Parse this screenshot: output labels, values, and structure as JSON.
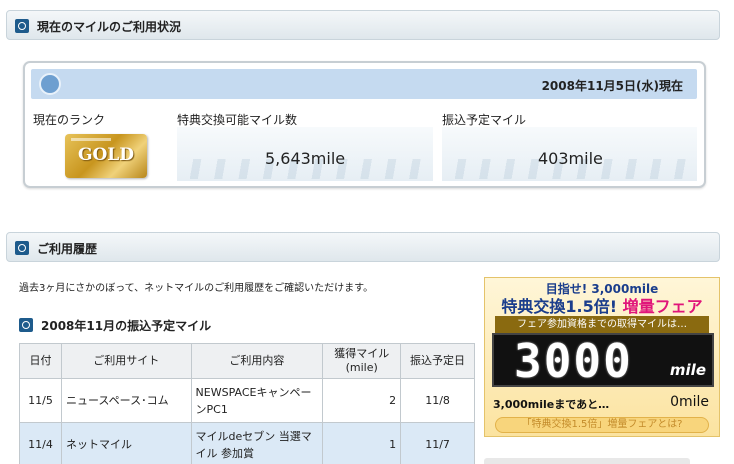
{
  "section_status": {
    "title": "現在のマイルのご利用状況"
  },
  "status": {
    "date": "2008年11月5日(水)現在",
    "rank_label": "現在のランク",
    "rank_value": "GOLD",
    "exchangeable_label": "特典交換可能マイル数",
    "exchangeable_value": "5,643mile",
    "scheduled_label": "振込予定マイル",
    "scheduled_value": "403mile"
  },
  "section_history": {
    "title": "ご利用履歴"
  },
  "history": {
    "intro": "過去3ヶ月にさかのぼって、ネットマイルのご利用履歴をご確認いただけます。",
    "month_title": "2008年11月の振込予定マイル",
    "columns": [
      "日付",
      "ご利用サイト",
      "ご利用内容",
      "獲得マイル\n(mile)",
      "振込予定日"
    ],
    "rows": [
      {
        "date": "11/5",
        "site": "ニュースペース･コム",
        "content": "NEWSPACEキャンペーンPC1",
        "miles": "2",
        "transfer": "11/8"
      },
      {
        "date": "11/4",
        "site": "ネットマイル",
        "content": "マイルdeセブン 当選マイル 参加賞",
        "miles": "1",
        "transfer": "11/7"
      }
    ]
  },
  "promo": {
    "line1": "目指せ! 3,000mile",
    "line2_a": "特典交換1.5倍!",
    "line2_b": "増量フェア",
    "line3": "フェア参加資格までの取得マイルは…",
    "digits": "3000",
    "unit": "mile",
    "until_label": "3,000mileまであと…",
    "remaining": "0mile",
    "button": "「特典交換1.5倍」増量フェアとは?"
  }
}
